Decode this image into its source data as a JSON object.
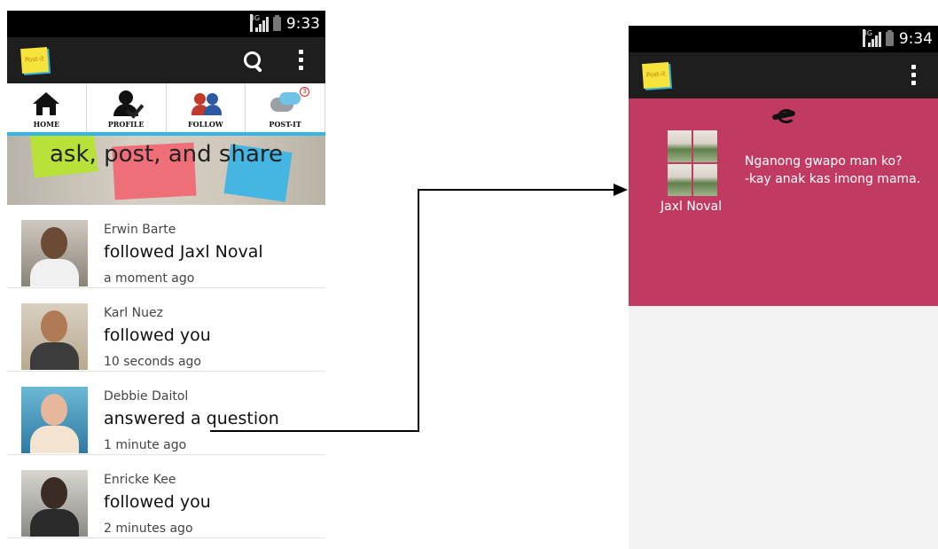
{
  "left_screen": {
    "status": {
      "network": "3G",
      "time": "9:33"
    },
    "app": {
      "logo_text": "Post-it"
    },
    "tabs": [
      {
        "label": "HOME"
      },
      {
        "label": "PROFILE"
      },
      {
        "label": "FOLLOW"
      },
      {
        "label": "POST-IT",
        "badge": "3"
      }
    ],
    "banner": {
      "text": "ask, post, and share"
    },
    "feed": [
      {
        "name": "Erwin Barte",
        "action": "followed Jaxl Noval",
        "time": "a moment ago"
      },
      {
        "name": "Karl Nuez",
        "action": "followed you",
        "time": "10 seconds ago"
      },
      {
        "name": "Debbie Daitol",
        "action": "answered a question",
        "time": "1 minute ago"
      },
      {
        "name": "Enricke Kee",
        "action": "followed you",
        "time": "2 minutes ago"
      }
    ]
  },
  "right_screen": {
    "status": {
      "network": "3G",
      "time": "9:34"
    },
    "app": {
      "logo_text": "Post-it"
    },
    "card": {
      "user": "Jaxl Noval",
      "question": "Nganong gwapo man ko?",
      "answer": "-kay anak kas imong mama."
    }
  },
  "colors": {
    "accent": "#33b5e5",
    "card": "#c13a62",
    "action_bar": "#1e1e1e"
  }
}
